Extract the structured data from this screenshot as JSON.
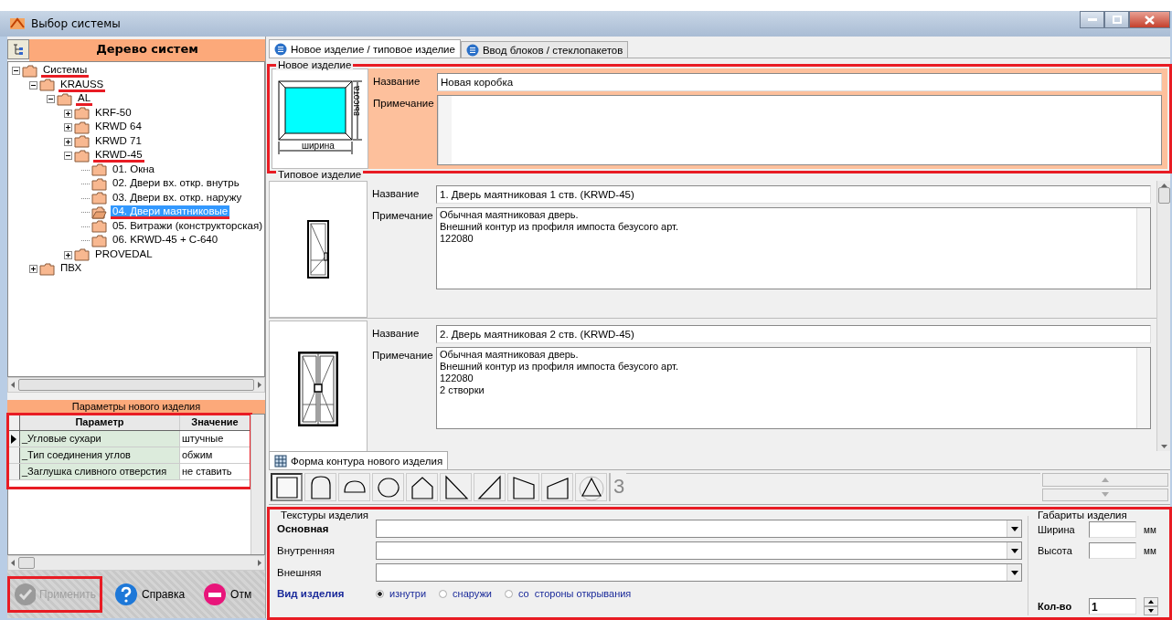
{
  "window": {
    "title": "Выбор системы"
  },
  "tree_panel": {
    "title": "Дерево систем",
    "nodes": [
      {
        "label": "Системы",
        "kind": "branch",
        "expanded": true,
        "selected": false,
        "underlined": true,
        "children": [
          {
            "label": "KRAUSS",
            "kind": "branch",
            "expanded": true,
            "selected": false,
            "underlined": true,
            "children": [
              {
                "label": "AL",
                "kind": "branch",
                "expanded": true,
                "selected": false,
                "underlined": true,
                "children": [
                  {
                    "label": "KRF-50",
                    "kind": "branch",
                    "expanded": false,
                    "selected": false,
                    "underlined": false
                  },
                  {
                    "label": "KRWD 64",
                    "kind": "branch",
                    "expanded": false,
                    "selected": false,
                    "underlined": false
                  },
                  {
                    "label": "KRWD 71",
                    "kind": "branch",
                    "expanded": false,
                    "selected": false,
                    "underlined": false
                  },
                  {
                    "label": "KRWD-45",
                    "kind": "branch",
                    "expanded": true,
                    "selected": false,
                    "underlined": true,
                    "children": [
                      {
                        "label": "01. Окна",
                        "kind": "leaf",
                        "selected": false,
                        "underlined": false
                      },
                      {
                        "label": "02. Двери вх. откр. внутрь",
                        "kind": "leaf",
                        "selected": false,
                        "underlined": false
                      },
                      {
                        "label": "03. Двери вх. откр. наружу",
                        "kind": "leaf",
                        "selected": false,
                        "underlined": false
                      },
                      {
                        "label": "04. Двери маятниковые",
                        "kind": "leaf",
                        "selected": true,
                        "underlined": true
                      },
                      {
                        "label": "05. Витражи (конструкторская)",
                        "kind": "leaf",
                        "selected": false,
                        "underlined": false
                      },
                      {
                        "label": "06. KRWD-45 + C-640",
                        "kind": "leaf",
                        "selected": false,
                        "underlined": false
                      }
                    ]
                  },
                  {
                    "label": "PROVEDAL",
                    "kind": "branch",
                    "expanded": false,
                    "selected": false,
                    "underlined": false
                  }
                ]
              }
            ]
          },
          {
            "label": "ПВХ",
            "kind": "branch",
            "expanded": false,
            "selected": false,
            "underlined": false
          }
        ]
      }
    ]
  },
  "params_panel": {
    "title": "Параметры нового изделия",
    "highlighted": true,
    "columns": [
      "Параметр",
      "Значение"
    ],
    "rows": [
      {
        "param": "_Угловые сухари",
        "value": "штучные",
        "current": true
      },
      {
        "param": "_Тип соединения углов",
        "value": "обжим",
        "current": false
      },
      {
        "param": "_Заглушка сливного отверстия",
        "value": "не ставить",
        "current": false
      }
    ]
  },
  "bottom_buttons": [
    {
      "label": "Применить",
      "kind": "ok",
      "disabled": true,
      "highlighted": true
    },
    {
      "label": "Справка",
      "kind": "help",
      "disabled": false,
      "highlighted": false
    },
    {
      "label": "Отм",
      "kind": "cancel",
      "disabled": false,
      "highlighted": false
    }
  ],
  "tabs": [
    {
      "label": "Новое изделие / типовое изделие",
      "selected": true
    },
    {
      "label": "Ввод блоков / стеклопакетов",
      "selected": false
    }
  ],
  "new_item": {
    "legend": "Новое изделие",
    "highlighted": true,
    "width_label": "ширина",
    "height_label": "высота",
    "name_label": "Название",
    "name_value": "Новая коробка",
    "note_label": "Примечание"
  },
  "typical_items": {
    "legend": "Типовое изделие",
    "items": [
      {
        "kind": "single-door",
        "name_label": "Название",
        "name_value": "1. Дверь маятниковая 1 ств. (KRWD-45)",
        "note_label": "Примечание",
        "note_lines": [
          "Обычная маятниковая дверь.",
          "Внешний контур из профиля импоста безусого арт.",
          "122080"
        ]
      },
      {
        "kind": "double-door",
        "name_label": "Название",
        "name_value": "2. Дверь маятниковая 2 ств. (KRWD-45)",
        "note_label": "Примечание",
        "note_lines": [
          "Обычная маятниковая дверь.",
          "Внешний контур из профиля импоста безусого арт.",
          "122080",
          "2 створки"
        ]
      }
    ]
  },
  "shape_tab": {
    "label": "Форма контура нового изделия",
    "shapes": [
      {
        "kind": "rectangle",
        "selected": true
      },
      {
        "kind": "arch",
        "selected": false
      },
      {
        "kind": "half-circle",
        "selected": false
      },
      {
        "kind": "circle",
        "selected": false
      },
      {
        "kind": "pentagon",
        "selected": false
      },
      {
        "kind": "right-triangle-left",
        "selected": false
      },
      {
        "kind": "right-triangle-right",
        "selected": false
      },
      {
        "kind": "trapezoid-left",
        "selected": false
      },
      {
        "kind": "trapezoid-right",
        "selected": false
      },
      {
        "kind": "triangle",
        "selected": false
      }
    ],
    "count": "3"
  },
  "textures": {
    "legend": "Текстуры изделия",
    "highlighted": true,
    "fields": [
      {
        "label": "Основная",
        "bold": true
      },
      {
        "label": "Внутренняя",
        "bold": false
      },
      {
        "label": "Внешняя",
        "bold": false
      }
    ],
    "view_label": "Вид изделия",
    "view_options": [
      {
        "label": "изнутри",
        "selected": true
      },
      {
        "label": "снаружи",
        "selected": false
      },
      {
        "label": "со  стороны открывания",
        "selected": false
      }
    ]
  },
  "dimensions": {
    "legend": "Габариты изделия",
    "fields": [
      {
        "label": "Ширина",
        "unit": "мм"
      },
      {
        "label": "Высота",
        "unit": "мм"
      }
    ],
    "qty_label": "Кол-во",
    "qty_value": "1"
  }
}
